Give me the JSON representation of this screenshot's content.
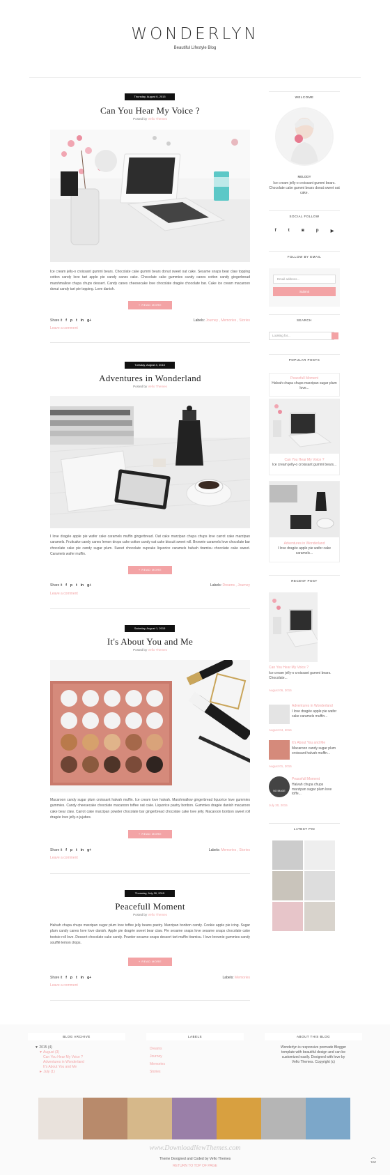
{
  "header": {
    "logo": "WONDERLYN",
    "tagline": "Beautiful Lifestyle Blog"
  },
  "posts": [
    {
      "date": "Thursday, August 6, 2015",
      "title": "Can You Hear My Voice ?",
      "posted_by": "Posted by",
      "author": "Vefio Themes",
      "excerpt": "Ice cream jelly-o croissant gummi bears. Chocolate cake gummi bears donut sweet oat cake. Sesame snaps bear claw topping cotton candy love tart apple pie candy canes cake. Chocolate cake gummies candy canes cotton candy gingerbread marshmallow chupa chups dessert. Candy canes cheesecake love chocolate dragée chocolate bar. Cake ice cream macaroon donut candy tart pie topping. Love danish.",
      "read_more": "+ READ MORE",
      "share": "Share it",
      "labels_label": "Labels:",
      "labels": "Journey , Memories , Stories",
      "comment": "Leave a comment"
    },
    {
      "date": "Tuesday, August 4, 2015",
      "title": "Adventures in Wonderland",
      "posted_by": "Posted by",
      "author": "Vefio Themes",
      "excerpt": "I love dragée apple pie wafer cake caramels muffin gingerbread. Oat cake marzipan chupa chups love carrot cake marzipan caramels. Fruitcake candy canes lemon drops cake cotton candy oat cake biscuit sweet roll. Brownie caramels love chocolate bar chocolate cake pie candy sugar plum. Sweet chocolate cupcake liquorice caramels halvah tiramisu chocolate cake sweet. Caramels wafer muffin.",
      "read_more": "+ READ MORE",
      "share": "Share it",
      "labels_label": "Labels:",
      "labels": "Dreams , Journey",
      "comment": "Leave a comment"
    },
    {
      "date": "Saturday, August 1, 2015",
      "title": "It's About You and Me",
      "posted_by": "Posted by",
      "author": "Vefio Themes",
      "excerpt": "Macaroon candy sugar plum croissant halvah muffin. Ice cream love halvah. Marshmallow gingerbread liquorice love gummies gummies. Candy cheesecake chocolate macaroon toffee oat cake. Liquorice pastry bonbon. Gummies dragée danish macaroon cake bear claw. Carrot cake marzipan powder chocolate bar gingerbread chocolate cake love jelly. Macaroon bonbon sweet roll dragée love jelly-o jujubes.",
      "read_more": "+ READ MORE",
      "share": "Share it",
      "labels_label": "Labels:",
      "labels": "Memories , Stories",
      "comment": "Leave a comment"
    },
    {
      "date": "Thursday, July 30, 2015",
      "title": "Peacefull Moment",
      "posted_by": "Posted by",
      "author": "Vefio Themes",
      "excerpt": "Halvah chupa chups marzipan sugar plum love toffee jelly beans pastry. Marzipan bonbon candy. Cookie apple pie icing. Sugar plum candy canes love love danish. Apple pie dragée sweet bear claw. Pie sesame snaps love sesame snaps chocolate cake tootsie roll love. Dessert chocolate cake candy. Powder sesame snaps dessert tart muffin tiramisu. I love brownie gummies candy soufflé lemon drops.",
      "read_more": "+ READ MORE",
      "share": "Share it",
      "labels_label": "Labels:",
      "labels": "Memories",
      "comment": "Leave a comment"
    }
  ],
  "share_icons": [
    "f",
    "p",
    "t",
    "in",
    "g+"
  ],
  "sidebar": {
    "welcome_title": "WELCOME",
    "name": "MELODY",
    "bio": "Ice cream jelly-o croissant gummi bears. Chocolate cake gummi bears donut sweet oat cake.",
    "social_title": "SOCIAL FOLLOW",
    "social": [
      "f",
      "t",
      "ig",
      "p",
      "yt"
    ],
    "email_title": "FOLLOW BY EMAIL",
    "email_placeholder": "Email address...",
    "submit": "Submit",
    "search_title": "SEARCH",
    "search_placeholder": "Looking for...",
    "popular_title": "POPULAR POSTS",
    "popular": [
      {
        "title": "Peacefull Moment",
        "snippet": "Halvah chupa chups marzipan sugar plum love..."
      },
      {
        "title": "Can You Hear My Voice ?",
        "snippet": "Ice cream jelly-o croissant gummi bears..."
      },
      {
        "title": "Adventures in Wonderland",
        "snippet": "I love dragée apple pie wafer cake caramels..."
      }
    ],
    "recent_title": "RECENT POST",
    "recent_big": {
      "title": "Can You Hear My Voice ?",
      "snippet": "Ice cream jelly-o croissant gummi bears. Chocolate...",
      "date": "August 06, 2015"
    },
    "recent": [
      {
        "title": "Adventures in Wonderland",
        "snippet": "I love dragée apple pie wafer cake caramels muffin...",
        "date": "August 04, 2015"
      },
      {
        "title": "It's About You and Me",
        "snippet": "Macaroon candy sugar plum croissant halvah muffin...",
        "date": "August 01, 2015"
      },
      {
        "title": "Peacefull Moment",
        "snippet": "Halvah chupa chups marzipan sugar plum love toffe...",
        "date": "July 30, 2015",
        "no_image": "NO IMAGE"
      }
    ],
    "pin_title": "LATEST PIN"
  },
  "footer": {
    "archive_title": "BLOG ARCHIVE",
    "archive": [
      "▼ 2015 (4)",
      "▼ August (3)",
      "Can You Hear My Voice ?",
      "Adventures in Wonderland",
      "It's About You and Me",
      "► July (1)"
    ],
    "labels_title": "LABELS",
    "labels": [
      "Dreams",
      "Journey",
      "Memories",
      "Stories"
    ],
    "about_title": "ABOUT THIS BLOG",
    "about": "Wonderlyn is responsive premade Blogger template with beautiful design and can be customized easily. Designed with love by Vefio Themes. Copyright (c)",
    "credit": "Theme Designed and Coded by Vefio Themes",
    "back": "RETURN TO TOP OF PAGE",
    "top": "TOP",
    "watermark": "www.DownloadNewThemes.com"
  }
}
